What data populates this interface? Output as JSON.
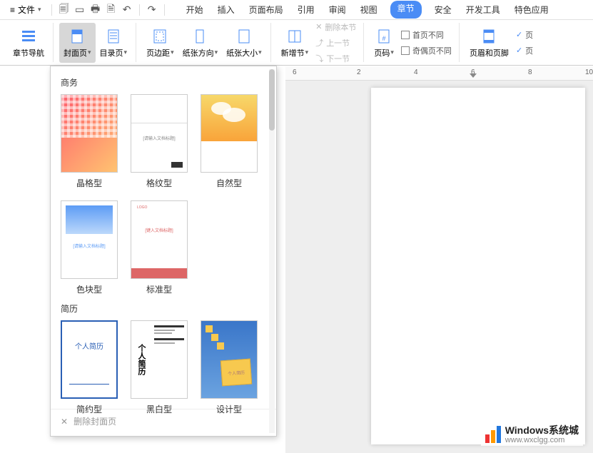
{
  "menubar": {
    "file_label": "文件",
    "quick": [
      "save",
      "open",
      "print",
      "preview",
      "undo",
      "redo"
    ]
  },
  "tabs": [
    "开始",
    "插入",
    "页面布局",
    "引用",
    "审阅",
    "视图",
    "章节",
    "安全",
    "开发工具",
    "特色应用"
  ],
  "active_tab_index": 6,
  "ribbon": {
    "section_nav": "章节导航",
    "cover_page": "封面页",
    "toc_page": "目录页",
    "margin": "页边距",
    "orientation": "纸张方向",
    "paper_size": "纸张大小",
    "new_section": "新增节",
    "delete_section": "删除本节",
    "prev_section": "上一节",
    "next_section": "下一节",
    "page_number": "页码",
    "first_diff": "首页不同",
    "odd_even_diff": "奇偶页不同",
    "header_footer": "页眉和页脚",
    "page_toggle": "页"
  },
  "ruler_numbers": [
    6,
    2,
    4,
    6,
    8,
    10
  ],
  "dropdown": {
    "section1_title": "商务",
    "section1_items": [
      {
        "label": "晶格型"
      },
      {
        "label": "格纹型"
      },
      {
        "label": "自然型"
      },
      {
        "label": "色块型"
      },
      {
        "label": "标准型"
      }
    ],
    "section2_title": "简历",
    "section2_items": [
      {
        "label": "简约型"
      },
      {
        "label": "黑白型"
      },
      {
        "label": "设计型"
      }
    ],
    "delete_cover": "删除封面页",
    "thumb_text_1": "[请输入文档标题]",
    "thumb_text_2": "[键入文档标题]",
    "thumb_text_3": "个人简历",
    "thumb_text_4": "个人简历",
    "thumb_text_5": "个人简历",
    "thumb_text_6": "LOGO"
  },
  "watermark": {
    "title": "Windows系统城",
    "url": "www.wxclgg.com"
  },
  "colors": {
    "accent": "#4a8cf5",
    "wm_red": "#e33",
    "wm_orange": "#f90",
    "wm_blue": "#27d"
  }
}
